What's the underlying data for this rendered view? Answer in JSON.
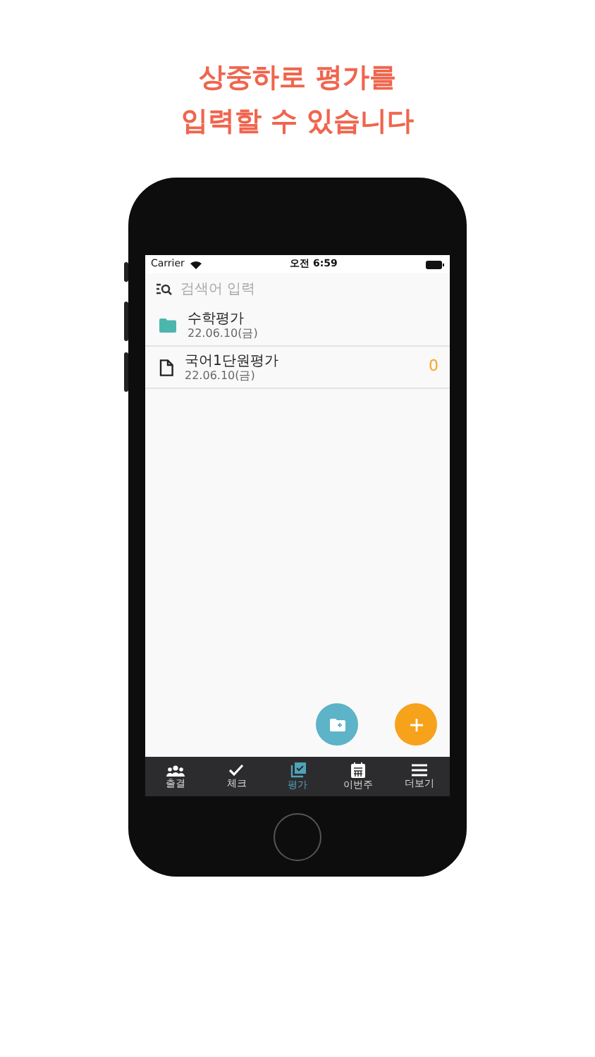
{
  "headline": [
    "상중하로 평가를",
    "입력할 수 있습니다"
  ],
  "status_bar": {
    "carrier": "Carrier",
    "time": "오전 6:59"
  },
  "search": {
    "placeholder": "검색어 입력"
  },
  "items": [
    {
      "kind": "folder",
      "title": "수학평가",
      "date": "22.06.10(금)"
    },
    {
      "kind": "document",
      "title": "국어1단원평가",
      "date": "22.06.10(금)",
      "count": "0"
    }
  ],
  "tabs": [
    {
      "kind": "people",
      "label": "출결",
      "selected": false
    },
    {
      "kind": "check",
      "label": "체크",
      "selected": false
    },
    {
      "kind": "evaluate",
      "label": "평가",
      "selected": true
    },
    {
      "kind": "calendar",
      "label": "이번주",
      "selected": false
    },
    {
      "kind": "menu",
      "label": "더보기",
      "selected": false
    }
  ]
}
